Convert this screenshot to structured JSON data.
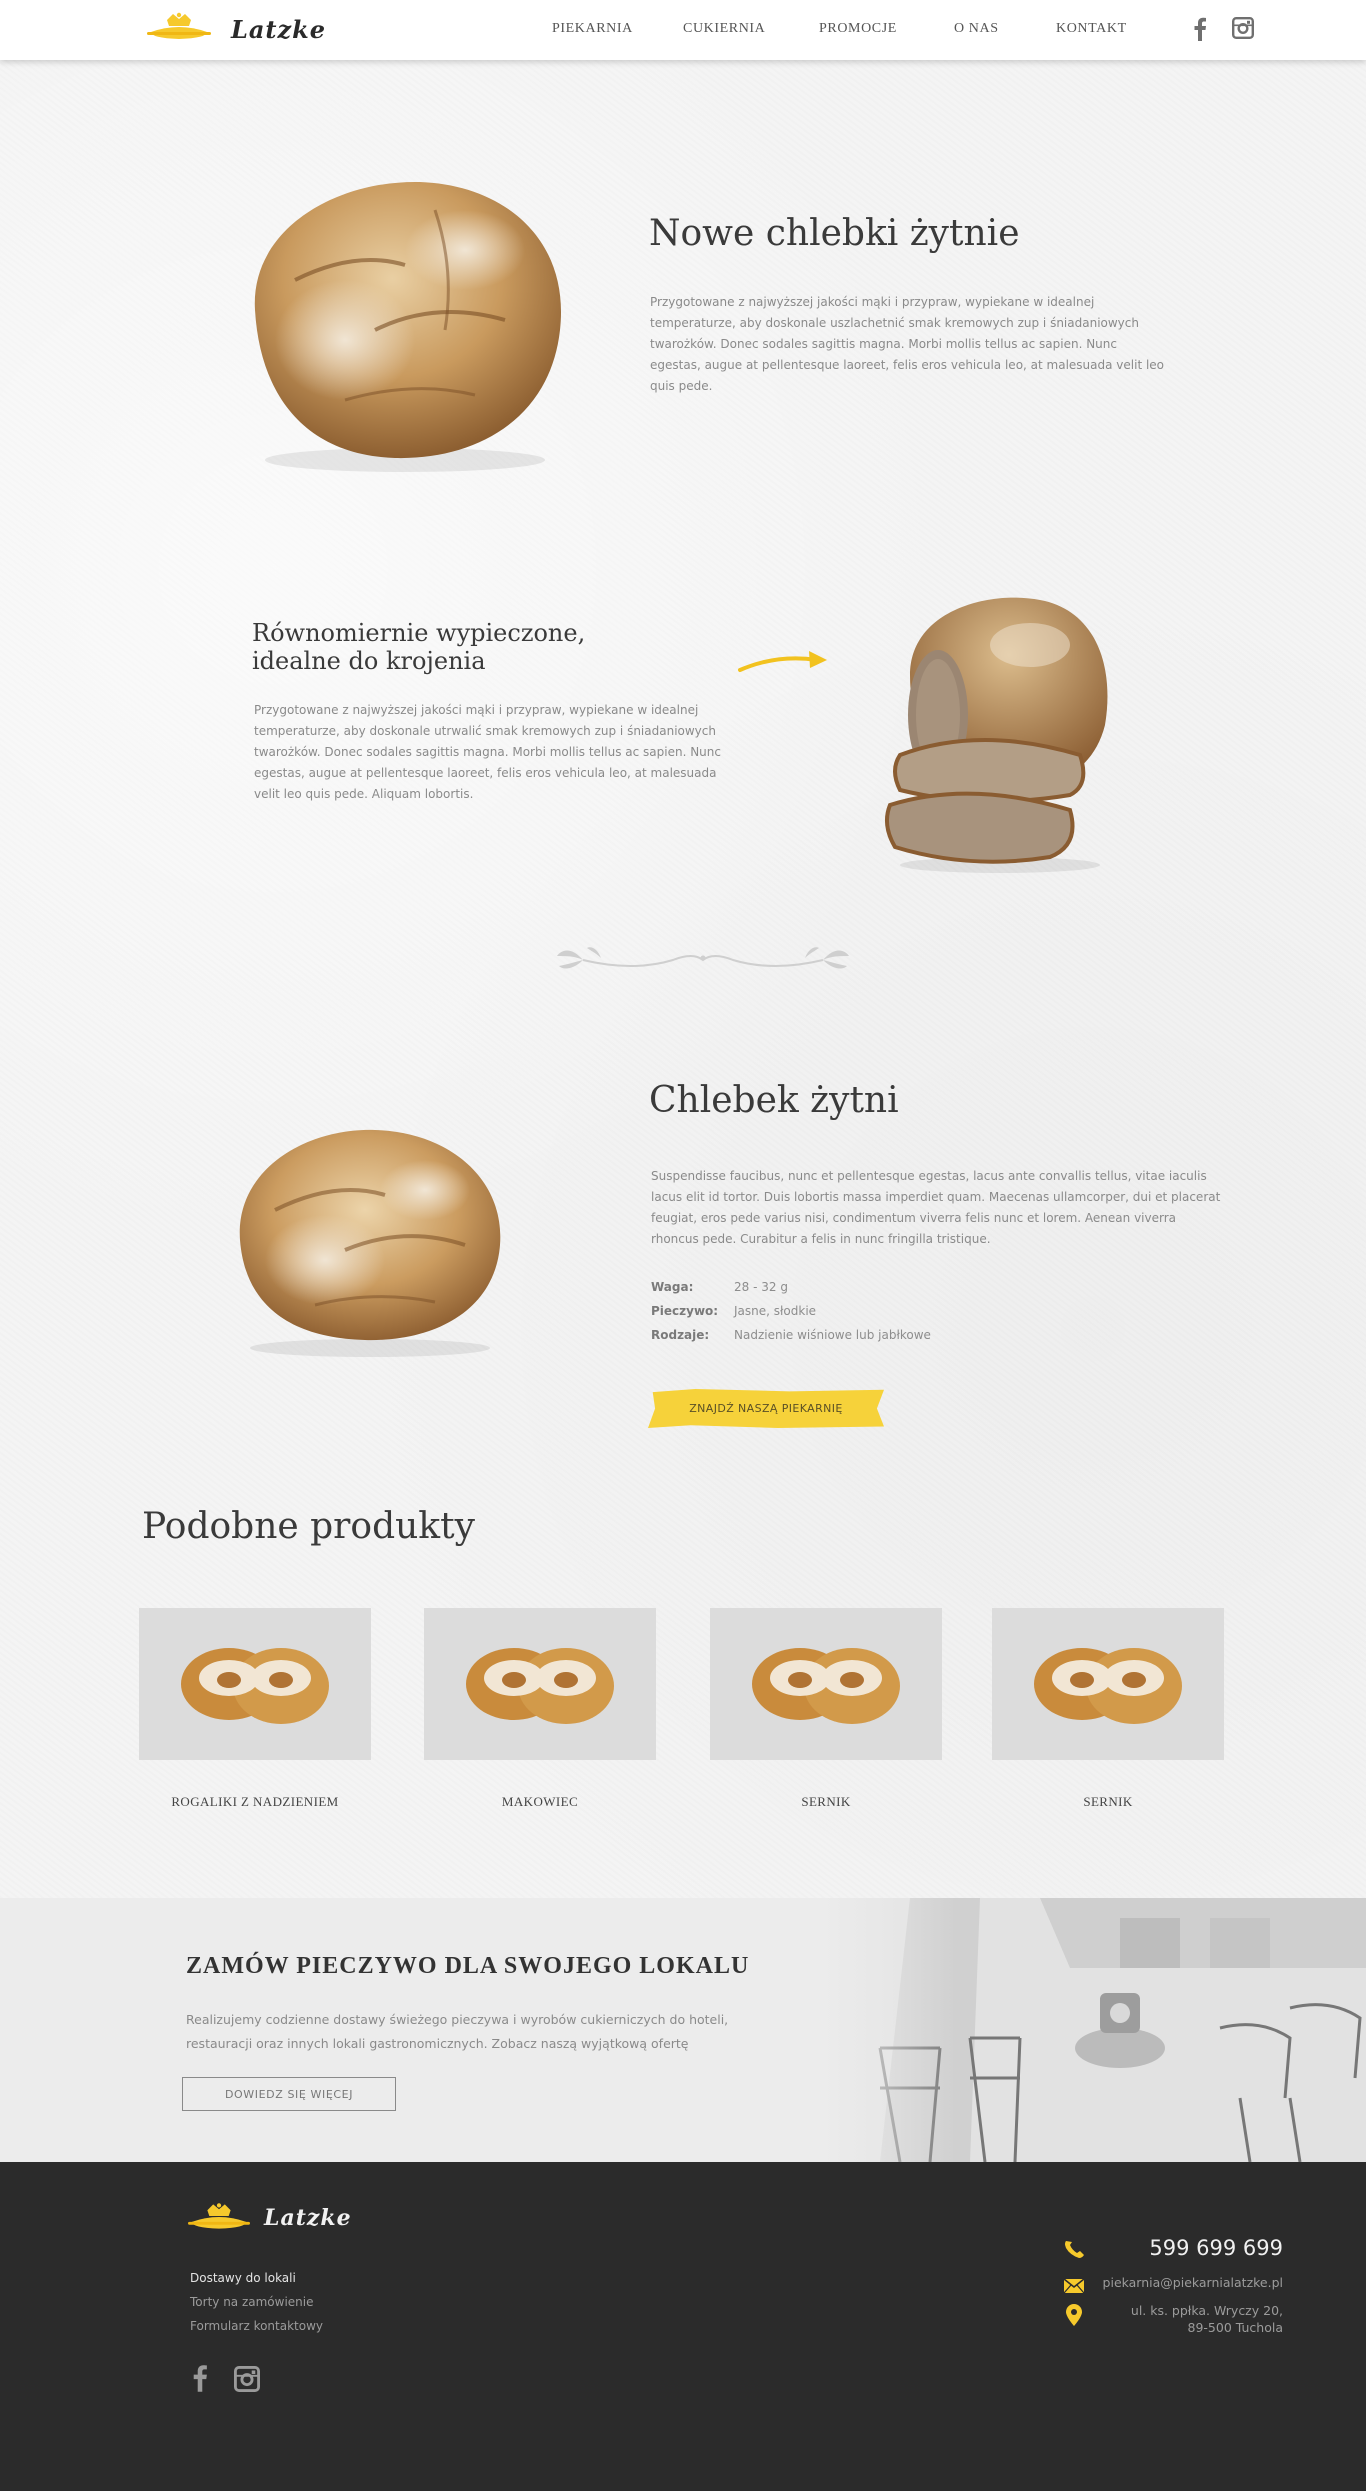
{
  "brand": {
    "name": "Latzke"
  },
  "nav": {
    "items": [
      {
        "label": "PIEKARNIA"
      },
      {
        "label": "CUKIERNIA"
      },
      {
        "label": "PROMOCJE"
      },
      {
        "label": "O NAS"
      },
      {
        "label": "KONTAKT"
      }
    ],
    "social": [
      "facebook-icon",
      "instagram-icon"
    ]
  },
  "hero": {
    "title": "Nowe chlebki żytnie",
    "text": "Przygotowane z najwyższej jakości mąki i przypraw, wypiekane w idealnej temperaturze, aby doskonale uszlachetnić smak kremowych zup i śniadaniowych twarożków. Donec sodales sagittis magna. Morbi mollis tellus ac sapien. Nunc egestas, augue at pellentesque laoreet, felis eros vehicula leo, at malesuada velit leo quis pede."
  },
  "feature": {
    "title_line1": "Równomiernie wypieczone,",
    "title_line2": "idealne do krojenia",
    "text": "Przygotowane z najwyższej jakości mąki i przypraw, wypiekane w idealnej temperaturze, aby doskonale utrwalić smak kremowych zup i śniadaniowych twarożków. Donec sodales sagittis magna. Morbi mollis tellus ac sapien. Nunc egestas, augue at pellentesque laoreet, felis eros vehicula leo, at malesuada velit leo quis pede. Aliquam lobortis."
  },
  "product": {
    "title": "Chlebek żytni",
    "text": "Suspendisse faucibus, nunc et pellentesque egestas, lacus ante convallis tellus, vitae iaculis lacus elit id tortor. Duis lobortis massa imperdiet quam. Maecenas ullamcorper, dui et placerat feugiat, eros pede varius nisi, condimentum viverra felis nunc et lorem. Aenean viverra rhoncus pede. Curabitur a felis in nunc fringilla tristique.",
    "specs": [
      {
        "label": "Waga:",
        "value": "28 - 32  g"
      },
      {
        "label": "Pieczywo:",
        "value": "Jasne, słodkie"
      },
      {
        "label": "Rodzaje:",
        "value": "Nadzienie wiśniowe lub jabłkowe"
      }
    ],
    "cta": "ZNAJDŹ NASZĄ PIEKARNIĘ"
  },
  "similar": {
    "title": "Podobne produkty",
    "items": [
      {
        "name": "ROGALIKI Z NADZIENIEM"
      },
      {
        "name": "MAKOWIEC"
      },
      {
        "name": "SERNIK"
      },
      {
        "name": "SERNIK"
      }
    ]
  },
  "banner": {
    "title": "ZAMÓW PIECZYWO DLA SWOJEGO LOKALU",
    "text": "Realizujemy codzienne dostawy świeżego pieczywa i wyrobów cukierniczych do hoteli, restauracji oraz innych lokali gastronomicznych. Zobacz naszą wyjątkową ofertę",
    "button": "DOWIEDZ SIĘ WIĘCEJ"
  },
  "footer": {
    "links": [
      {
        "label": "Dostawy do lokali"
      },
      {
        "label": "Torty na zamówienie"
      },
      {
        "label": "Formularz kontaktowy"
      }
    ],
    "phone": "599 699 699",
    "email": "piekarnia@piekarnialatzke.pl",
    "address_line1": "ul. ks. ppłka. Wryczy 20,",
    "address_line2": "89-500 Tuchola"
  },
  "colors": {
    "accent": "#f6c92c",
    "footer_bg": "#2b2b2b",
    "text_dark": "#3a3a3a",
    "text_muted": "#8a8a8a"
  }
}
